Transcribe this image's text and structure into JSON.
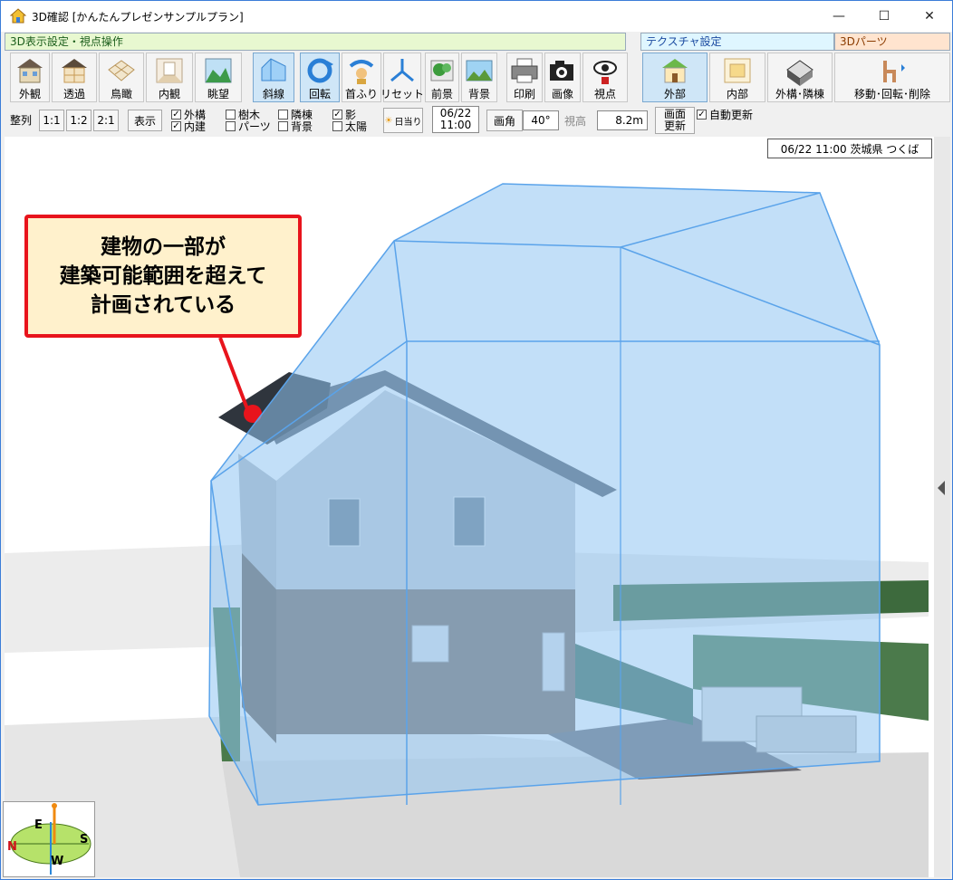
{
  "window": {
    "title": "3D確認 [かんたんプレゼンサンプルプラン]",
    "controls": [
      "—",
      "☐",
      "✕"
    ]
  },
  "sections": {
    "display": "3D表示設定・視点操作",
    "texture": "テクスチャ設定",
    "parts": "3Dパーツ"
  },
  "toolbar": {
    "buttons": [
      {
        "label": "外観",
        "icon": "house-exterior-icon"
      },
      {
        "label": "透過",
        "icon": "house-transparent-icon"
      },
      {
        "label": "鳥瞰",
        "icon": "birdseye-icon"
      },
      {
        "label": "内観",
        "icon": "interior-room-icon"
      },
      {
        "label": "眺望",
        "icon": "landscape-view-icon"
      },
      {
        "label": "斜線",
        "icon": "slant-line-icon"
      },
      {
        "label": "回転",
        "icon": "rotate-icon"
      },
      {
        "label": "首ふり",
        "icon": "swivel-icon"
      },
      {
        "label": "リセット",
        "icon": "reset-icon"
      },
      {
        "label": "前景",
        "icon": "foreground-icon"
      },
      {
        "label": "背景",
        "icon": "background-icon"
      },
      {
        "label": "印刷",
        "icon": "printer-icon"
      },
      {
        "label": "画像",
        "icon": "camera-icon"
      },
      {
        "label": "視点",
        "icon": "eye-viewpoint-icon"
      },
      {
        "label": "外部",
        "icon": "exterior-texture-icon"
      },
      {
        "label": "内部",
        "icon": "interior-texture-icon"
      },
      {
        "label": "外構･隣棟",
        "icon": "exterior-structure-icon"
      },
      {
        "label": "移動･回転･削除",
        "icon": "parts-move-icon"
      }
    ]
  },
  "controls": {
    "align": "整列",
    "ratio_1_1": "1:1",
    "ratio_1_2": "1:2",
    "ratio_2_1": "2:1",
    "display": "表示",
    "checks": [
      {
        "label": "外構",
        "checked": true
      },
      {
        "label": "内建",
        "checked": true
      },
      {
        "label": "樹木",
        "checked": false
      },
      {
        "label": "パーツ",
        "checked": false
      },
      {
        "label": "隣棟",
        "checked": false
      },
      {
        "label": "背景",
        "checked": false
      },
      {
        "label": "影",
        "checked": true
      },
      {
        "label": "太陽",
        "checked": false
      }
    ],
    "sun_button": "日当り",
    "date": "06/22",
    "time": "11:00",
    "fov_label": "画角",
    "fov_value": "40°",
    "eye_height_label": "視高",
    "eye_height_value": "8.2m",
    "refresh_line1": "画面",
    "refresh_line2": "更新",
    "auto_update": "自動更新",
    "auto_update_checked": true
  },
  "status": "06/22 11:00 茨城県 つくば",
  "callout": "建物の一部が\n建築可能範囲を超えて\n計画されている",
  "compass": {
    "n": "N",
    "s": "S",
    "e": "E",
    "w": "W"
  },
  "colors": {
    "envelope_fill": "#8fc4f2",
    "envelope_stroke": "#5aa3ea",
    "callout_border": "#e8141c",
    "callout_fill": "#fff1cc"
  }
}
